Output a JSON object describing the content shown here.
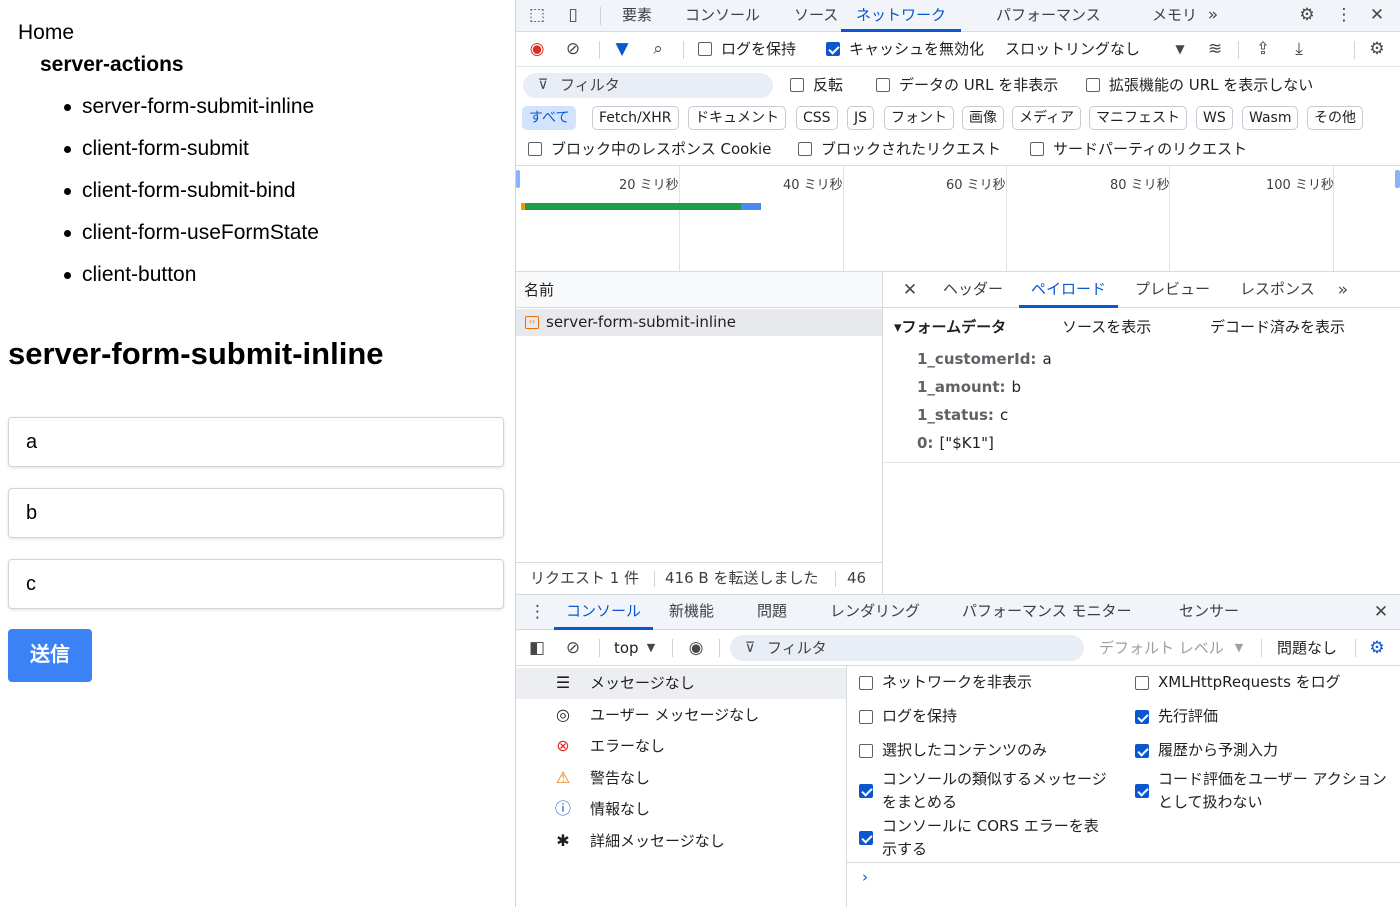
{
  "page": {
    "home": "Home",
    "section": "server-actions",
    "links": [
      "server-form-submit-inline",
      "client-form-submit",
      "client-form-submit-bind",
      "client-form-useFormState",
      "client-button"
    ],
    "heading": "server-form-submit-inline",
    "fields": [
      "a",
      "b",
      "c"
    ],
    "submit": "送信"
  },
  "devtools": {
    "tabs": [
      "要素",
      "コンソール",
      "ソース",
      "ネットワーク",
      "パフォーマンス",
      "メモリ"
    ],
    "active_tab": "ネットワーク",
    "toolbar": {
      "preserve_log": "ログを保持",
      "disable_cache": "キャッシュを無効化",
      "throttling": "スロットリングなし"
    },
    "filter": {
      "placeholder": "フィルタ",
      "invert": "反転",
      "hide_data_urls": "データの URL を非表示",
      "hide_ext_urls": "拡張機能の URL を表示しない"
    },
    "types": [
      "すべて",
      "Fetch/XHR",
      "ドキュメント",
      "CSS",
      "JS",
      "フォント",
      "画像",
      "メディア",
      "マニフェスト",
      "WS",
      "Wasm",
      "その他"
    ],
    "block": {
      "blocked_cookies": "ブロック中のレスポンス Cookie",
      "blocked_requests": "ブロックされたリクエスト",
      "third_party": "サードパーティのリクエスト"
    },
    "timeline_ticks": [
      "20 ミリ秒",
      "40 ミリ秒",
      "60 ミリ秒",
      "80 ミリ秒",
      "100 ミリ秒"
    ],
    "request_list": {
      "header": "名前",
      "rows": [
        "server-form-submit-inline"
      ],
      "status": [
        "リクエスト 1 件",
        "416 B を転送しました",
        "46"
      ]
    },
    "detail": {
      "tabs": [
        "ヘッダー",
        "ペイロード",
        "プレビュー",
        "レスポンス"
      ],
      "active": "ペイロード",
      "section": "▾フォームデータ",
      "view_source": "ソースを表示",
      "view_decoded": "デコード済みを表示",
      "form": [
        {
          "key": "1_customerId:",
          "value": "a"
        },
        {
          "key": "1_amount:",
          "value": "b"
        },
        {
          "key": "1_status:",
          "value": "c"
        },
        {
          "key": "0:",
          "value": "[\"$K1\"]"
        }
      ]
    },
    "drawer": {
      "tabs": [
        "コンソール",
        "新機能",
        "問題",
        "レンダリング",
        "パフォーマンス モニター",
        "センサー"
      ],
      "context": "top",
      "filter_placeholder": "フィルタ",
      "level": "デフォルト レベル",
      "issues": "問題なし"
    },
    "sidebar": [
      {
        "icon": "list-icon",
        "label": "メッセージなし"
      },
      {
        "icon": "user-icon",
        "label": "ユーザー メッセージなし"
      },
      {
        "icon": "error-icon",
        "label": "エラーなし"
      },
      {
        "icon": "warning-icon",
        "label": "警告なし"
      },
      {
        "icon": "info-icon",
        "label": "情報なし"
      },
      {
        "icon": "bug-icon",
        "label": "詳細メッセージなし"
      }
    ],
    "settings": [
      {
        "label": "ネットワークを非表示",
        "checked": false
      },
      {
        "label": "XMLHttpRequests をログ",
        "checked": false
      },
      {
        "label": "ログを保持",
        "checked": false
      },
      {
        "label": "先行評価",
        "checked": true
      },
      {
        "label": "選択したコンテンツのみ",
        "checked": false
      },
      {
        "label": "履歴から予測入力",
        "checked": true
      },
      {
        "label": "コンソールの類似するメッセージをまとめる",
        "checked": true
      },
      {
        "label": "コード評価をユーザー アクションとして扱わない",
        "checked": true
      },
      {
        "label": "コンソールに CORS エラーを表示する",
        "checked": true
      }
    ],
    "colors": {
      "accent": "#0b57d0",
      "submit": "#3b82f6",
      "waterfall_green": "#1e9e4b",
      "waterfall_blue": "#4a8af4"
    }
  }
}
